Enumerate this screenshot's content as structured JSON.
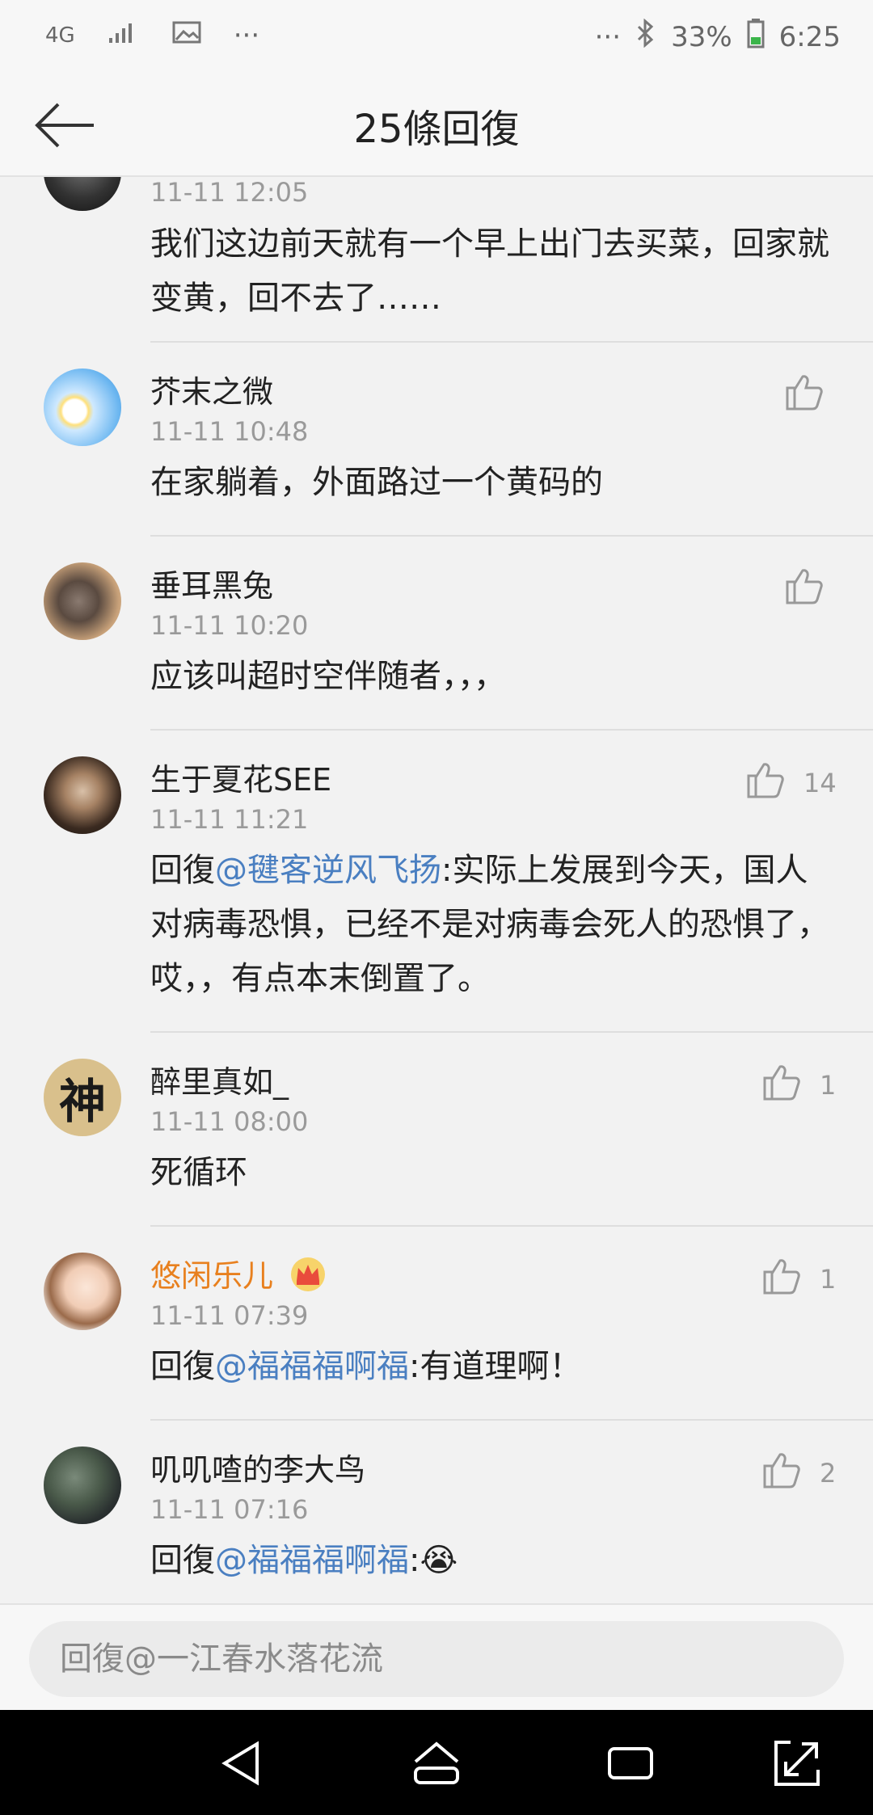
{
  "status_bar": {
    "network": "4G",
    "dots_left": "···",
    "dots_right": "···",
    "battery": "33%",
    "time": "6:25"
  },
  "header": {
    "title": "25條回復"
  },
  "comments": [
    {
      "user": "",
      "time": "11-11 12:05",
      "text": "我们这边前天就有一个早上出门去买菜，回家就变黄，回不去了……",
      "likes": ""
    },
    {
      "user": "芥末之微",
      "time": "11-11 10:48",
      "text": "在家躺着，外面路过一个黄码的",
      "likes": ""
    },
    {
      "user": "垂耳黑兔",
      "time": "11-11 10:20",
      "text": "应该叫超时空伴随者，，，",
      "likes": ""
    },
    {
      "user": "生于夏花SEE",
      "time": "11-11 11:21",
      "reply_prefix": "回復",
      "mention": "@毽客逆风飞扬",
      "text": ":实际上发展到今天，国人对病毒恐惧，已经不是对病毒会死人的恐惧了，哎，，有点本末倒置了。",
      "likes": "14"
    },
    {
      "user": "醉里真如_",
      "time": "11-11 08:00",
      "text": "死循环",
      "likes": "1",
      "avatar_char": "神"
    },
    {
      "user": "悠闲乐儿",
      "time": "11-11 07:39",
      "reply_prefix": "回復",
      "mention": "@福福福啊福",
      "text": ":有道理啊！",
      "likes": "1",
      "badge": "crown-icon"
    },
    {
      "user": "叽叽喳的李大鸟",
      "time": "11-11 07:16",
      "reply_prefix": "回復",
      "mention": "@福福福啊福",
      "text": ":",
      "likes": "2",
      "emoji": "😭"
    }
  ],
  "reply_input": {
    "placeholder": "回復@一江春水落花流"
  },
  "colors": {
    "mention": "#4a7fc1",
    "vip_name": "#e8801e"
  }
}
